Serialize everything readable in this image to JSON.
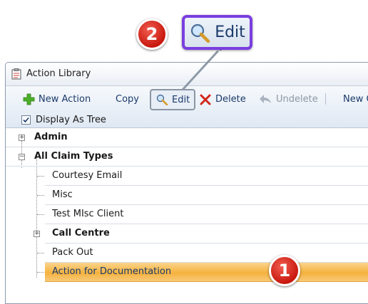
{
  "window": {
    "title": "Action Library"
  },
  "toolbar": {
    "new_action": "New Action",
    "copy": "Copy",
    "edit": "Edit",
    "delete": "Delete",
    "undelete": "Undelete",
    "new_cut": "New C",
    "display_as_tree": "Display As Tree",
    "display_as_tree_checked": true
  },
  "tree": {
    "admin": "Admin",
    "all_claim_types": "All Claim Types",
    "children": [
      "Courtesy Email",
      "Misc",
      "Test MIsc Client",
      "Call Centre",
      "Pack Out",
      "Action for Documentation"
    ],
    "selected": "Action for Documentation"
  },
  "callouts": {
    "step1": "1",
    "step2": "2",
    "zoom_label": "Edit",
    "badge_color": "#d6261b",
    "zoom_border_color": "#7a3ee0"
  }
}
